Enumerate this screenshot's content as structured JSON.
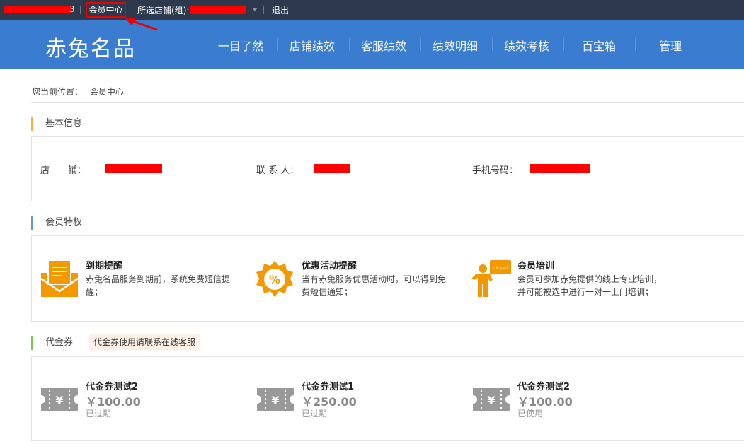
{
  "topbar": {
    "member_center": "会员中心",
    "store_label": "所选店铺(组):",
    "logout": "退出",
    "user_suffix": "3"
  },
  "nav": {
    "logo": "赤兔名品",
    "items": [
      "一目了然",
      "店铺绩效",
      "客服绩效",
      "绩效明细",
      "绩效考核",
      "百宝箱",
      "管理"
    ]
  },
  "breadcrumb": {
    "label": "您当前位置：",
    "current": "会员中心"
  },
  "basic_info": {
    "title": "基本信息",
    "store_label": "店　　铺：",
    "contact_label": "联 系 人：",
    "phone_label": "手机号码："
  },
  "privileges": {
    "title": "会员特权",
    "items": [
      {
        "title": "到期提醒",
        "desc": "赤兔名品服务到期前，系统免费短信提醒；",
        "icon": "envelope-icon"
      },
      {
        "title": "优惠活动提醒",
        "desc": "当有赤兔服务优惠活动时，可以得到免费短信通知；",
        "icon": "discount-badge-icon"
      },
      {
        "title": "会员培训",
        "desc": "会员可参加赤兔提供的线上专业培训，并可能被选中进行一对一上门培训；",
        "icon": "trainer-icon"
      }
    ]
  },
  "vouchers": {
    "title": "代金券",
    "note": "代金券使用请联系在线客服",
    "items": [
      {
        "name": "代金券测试2",
        "amount": "￥100.00",
        "status": "已过期"
      },
      {
        "name": "代金券测试1",
        "amount": "￥250.00",
        "status": "已过期"
      },
      {
        "name": "代金券测试2",
        "amount": "￥100.00",
        "status": "已使用"
      }
    ]
  },
  "colors": {
    "topbar_bg": "#2d3a4e",
    "nav_bg": "#3a7ccf",
    "accent_orange": "#f39800",
    "highlight_red": "#ee0000"
  }
}
